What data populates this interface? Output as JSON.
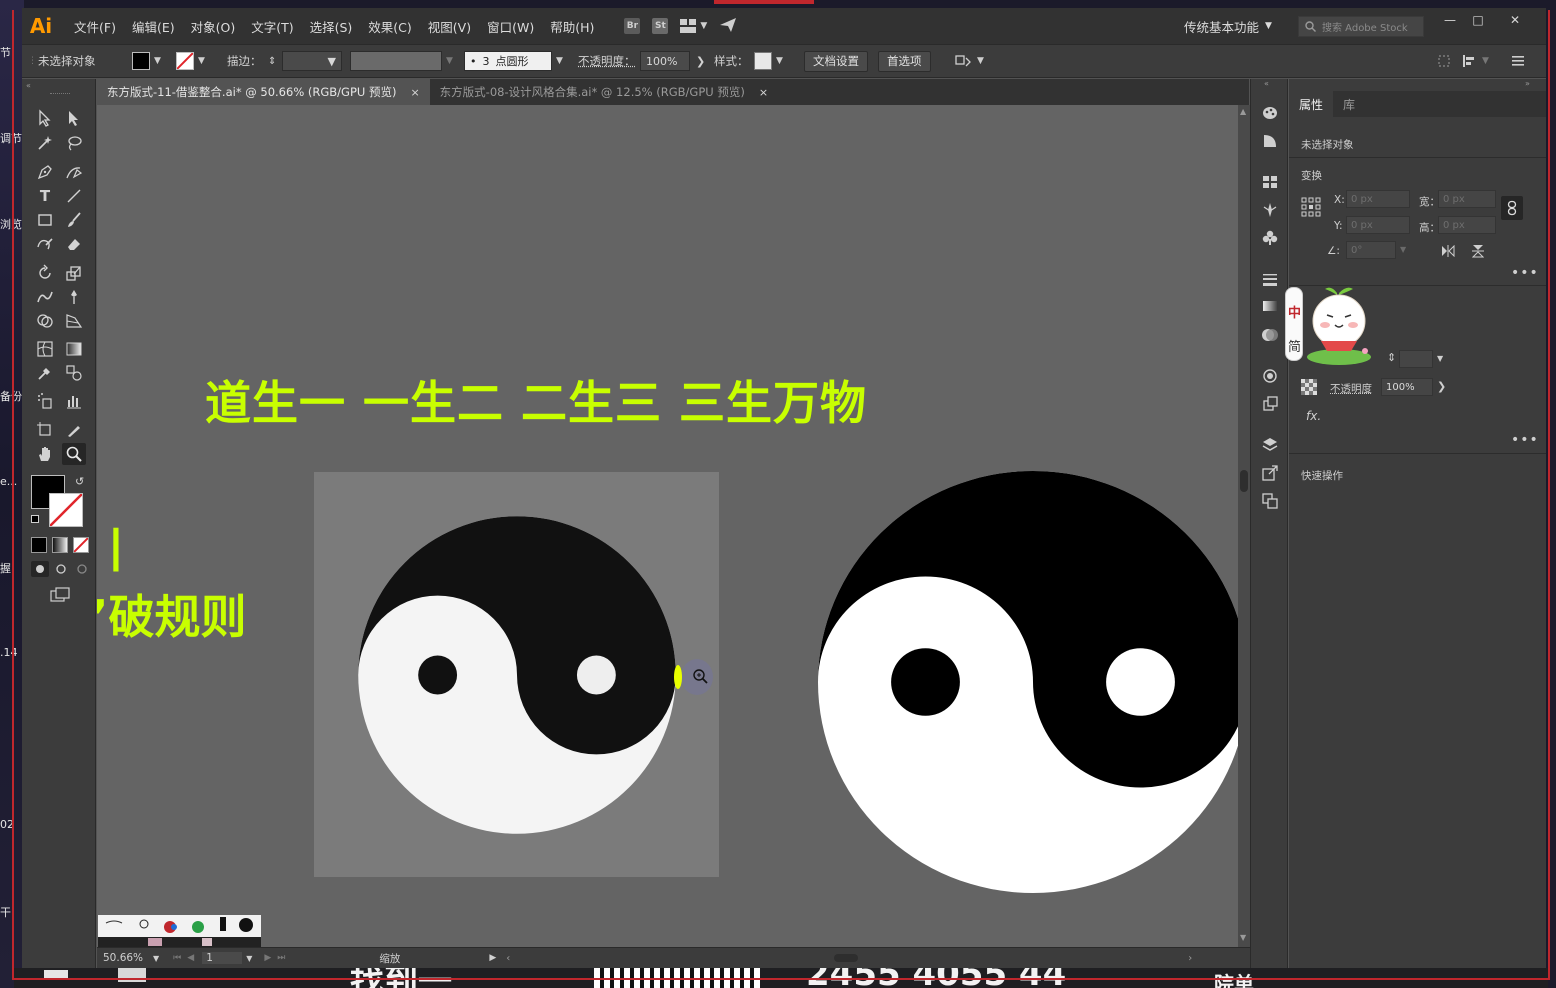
{
  "desktop": {
    "side_labels": [
      "节",
      "调节",
      "浏览",
      "备份",
      "e...",
      "握",
      ".14",
      "02",
      "干"
    ],
    "bottom_fragments": [
      "找到一",
      "2455 4055 44",
      "院单"
    ]
  },
  "app": {
    "logo": "Ai",
    "menu": [
      "文件(F)",
      "编辑(E)",
      "对象(O)",
      "文字(T)",
      "选择(S)",
      "效果(C)",
      "视图(V)",
      "窗口(W)",
      "帮助(H)"
    ],
    "bridge_label": "Br",
    "stock_label": "St",
    "workspace": "传统基本功能",
    "stock_search_placeholder": "搜索 Adobe Stock"
  },
  "control": {
    "selection": "未选择对象",
    "stroke_label": "描边：",
    "brush_dot": "•",
    "brush_size": "3",
    "brush_name": "点圆形",
    "opacity_label": "不透明度：",
    "opacity_value": "100%",
    "style_label": "样式：",
    "doc_setup": "文档设置",
    "preferences": "首选项"
  },
  "tabs": [
    {
      "title": "东方版式-11-借鉴整合.ai* @ 50.66% (RGB/GPU 预览)",
      "close": "×"
    },
    {
      "title": "东方版式-08-设计风格合集.ai* @ 12.5% (RGB/GPU 预览)",
      "close": "×"
    }
  ],
  "canvas": {
    "headline": "道生一 一生二 二生三 三生万物",
    "partial_text": "破规则",
    "partial_glyph": "丨"
  },
  "status": {
    "zoom": "50.66%",
    "artboard": "1",
    "mode": "缩放"
  },
  "panel": {
    "tabs": [
      "属性",
      "库"
    ],
    "selection": "未选择对象",
    "transform": "变换",
    "x_label": "X:",
    "y_label": "Y:",
    "w_label": "宽：",
    "h_label": "高：",
    "x_value": "0 px",
    "y_value": "0 px",
    "w_value": "0 px",
    "h_value": "0 px",
    "angle_value": "0°",
    "ime_zh": "中",
    "ime_simplified": "简",
    "opacity_label": "不透明度",
    "opacity_value": "100%",
    "fx": "fx.",
    "quick_actions": "快速操作",
    "more": "•••"
  },
  "colors": {
    "accent_yellow": "#c8ff00",
    "logo_orange": "#ff9a00",
    "canvas_bg": "#646464",
    "artboard": "#7b7b7b"
  }
}
